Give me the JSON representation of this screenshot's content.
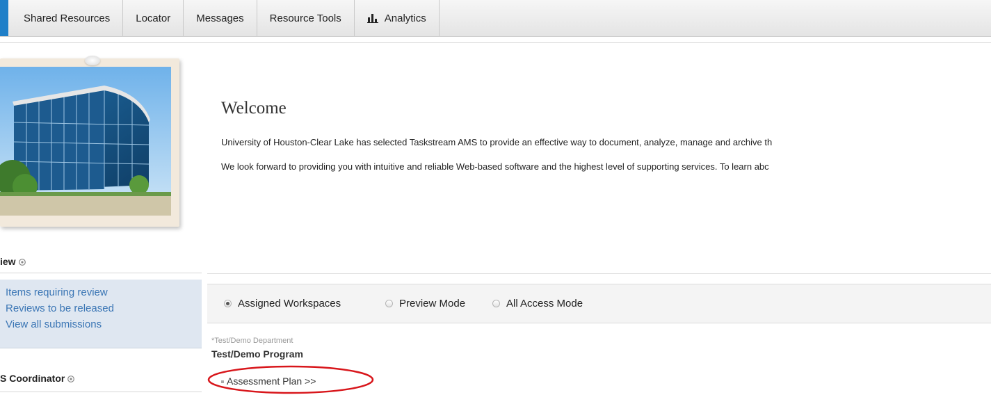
{
  "nav": {
    "tabs": [
      {
        "label": "Shared Resources"
      },
      {
        "label": "Locator"
      },
      {
        "label": "Messages"
      },
      {
        "label": "Resource Tools"
      },
      {
        "label": "Analytics",
        "icon": "bar-chart-icon"
      }
    ],
    "accent_color": "#1f7fc8"
  },
  "welcome": {
    "title": "Welcome",
    "paragraph_1": "University of Houston-Clear Lake has selected Taskstream AMS to provide an effective way to document, analyze, manage and archive th",
    "paragraph_2": "We look forward to providing you with intuitive and reliable Web-based software and the highest level of supporting services. To learn abc"
  },
  "sidebar": {
    "review_heading": "iew",
    "review_links": [
      {
        "label": "Items requiring review"
      },
      {
        "label": "Reviews to be released"
      },
      {
        "label": "View all submissions"
      }
    ],
    "coordinator_heading": "S Coordinator",
    "link_color": "#3b76b5"
  },
  "workspace": {
    "modes": [
      {
        "label": "Assigned Workspaces",
        "checked": true
      },
      {
        "label": "Preview Mode",
        "checked": false
      },
      {
        "label": "All Access Mode",
        "checked": false
      }
    ],
    "department": "*Test/Demo Department",
    "program": "Test/Demo Program",
    "items": [
      {
        "label": "Assessment Plan >>"
      }
    ]
  },
  "annotation": {
    "color": "#d8161b"
  }
}
